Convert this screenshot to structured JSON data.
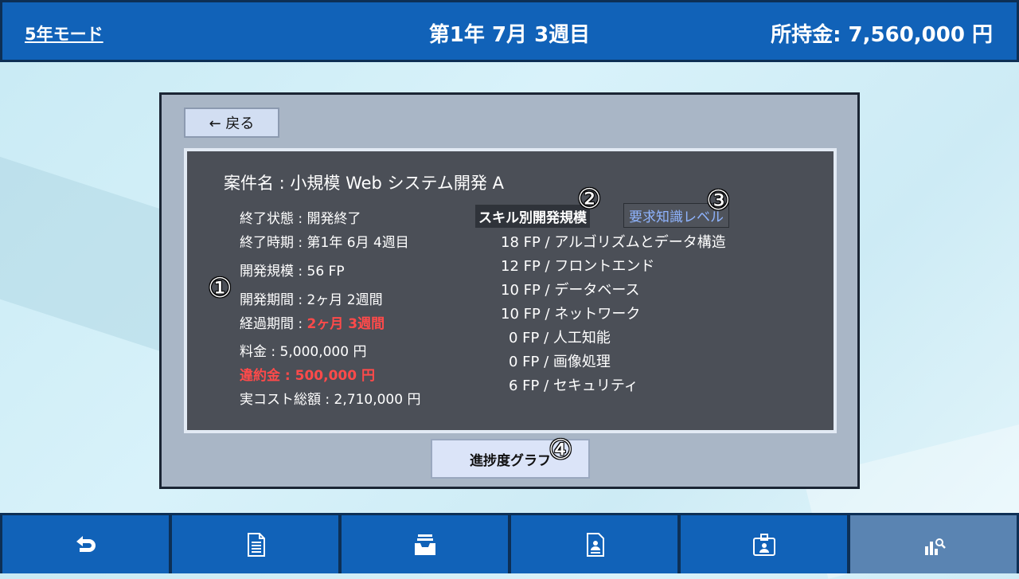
{
  "header": {
    "mode": "5年モード",
    "date": "第1年 7月 3週目",
    "money": "所持金: 7,560,000 円"
  },
  "panel": {
    "back_label": "← 戻る",
    "project_title": "案件名 : 小規模 Web システム開発 A",
    "details": {
      "status": "終了状態 : 開発終了",
      "end_time": "終了時期 : 第1年 6月 4週目",
      "scale": "開発規模 : 56 FP",
      "period": "開発期間 : 2ヶ月 2週間",
      "elapsed_label": "経過期間 : ",
      "elapsed_value": "2ヶ月 3週間",
      "fee": "料金 : 5,000,000 円",
      "penalty": "違約金 : 500,000 円",
      "cost_total": "実コスト総額 : 2,710,000 円"
    },
    "tabs": {
      "skill_scale": "スキル別開発規模",
      "knowledge_level": "要求知識レベル"
    },
    "skills": [
      "18 FP / アルゴリズムとデータ構造",
      "12 FP / フロントエンド",
      "10 FP / データベース",
      "10 FP / ネットワーク",
      "0 FP / 人工知能",
      "0 FP / 画像処理",
      "6 FP / セキュリティ"
    ],
    "graph_button": "進捗度グラフ",
    "markers": [
      "①",
      "②",
      "③",
      "④"
    ]
  },
  "colors": {
    "bar_blue": "#1162b8",
    "bar_border": "#0d2f55",
    "panel_gray": "#a9b6c6",
    "inner_dark": "#4b4f57",
    "warning_red": "#ff4a4a",
    "active_nav": "#5a84b2"
  },
  "bottom_nav": [
    {
      "icon": "undo-arrow-icon"
    },
    {
      "icon": "document-list-icon"
    },
    {
      "icon": "inbox-tray-icon"
    },
    {
      "icon": "person-document-icon"
    },
    {
      "icon": "id-badge-icon"
    },
    {
      "icon": "chart-search-icon",
      "active": true
    }
  ]
}
